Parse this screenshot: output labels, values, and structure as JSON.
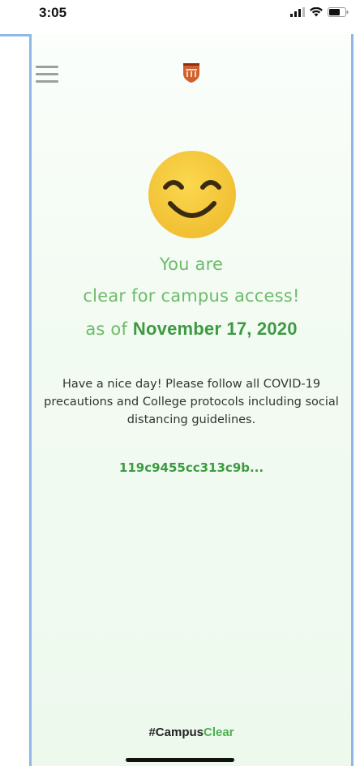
{
  "status_bar": {
    "time": "3:05",
    "icons": [
      "signal-icon",
      "wifi-icon",
      "battery-icon"
    ]
  },
  "header": {
    "menu_icon": "hamburger-menu-icon",
    "logo_icon": "college-crest-logo"
  },
  "status": {
    "icon": "smiling-face-icon",
    "line1": "You are",
    "line2": "clear for campus access!",
    "line3_prefix": "as of ",
    "date": "November 17, 2020",
    "message": "Have a nice day! Please follow all COVID-19 precautions and College protocols including social distancing guidelines.",
    "token": "119c9455cc313c9b..."
  },
  "footer": {
    "hashtag_part1": "#Campus",
    "hashtag_part2": "Clear"
  },
  "colors": {
    "accent_green": "#6dbb6a",
    "dark_green": "#3e9a42",
    "smiley_yellow": "#f5c842",
    "frame_blue": "#8fb8e8",
    "logo_orange": "#d2602d"
  }
}
